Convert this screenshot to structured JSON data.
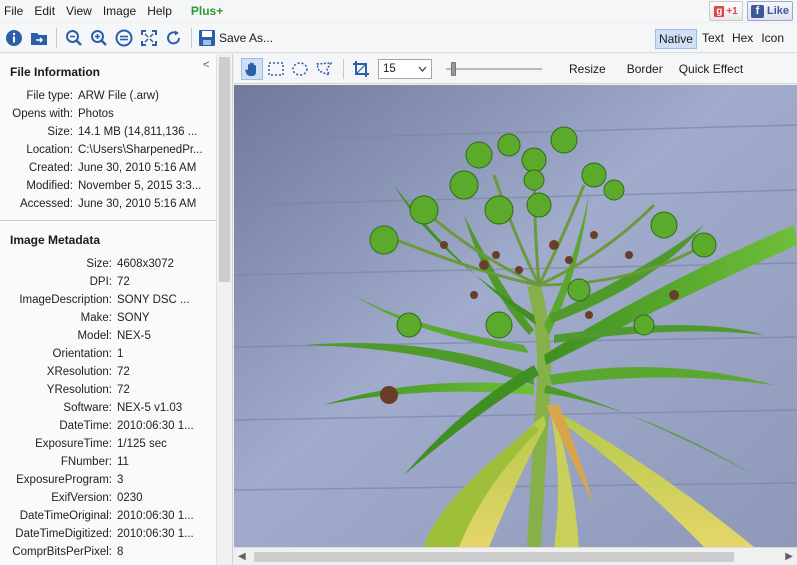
{
  "menu": [
    "File",
    "Edit",
    "View",
    "Image",
    "Help"
  ],
  "plus_label": "Plus+",
  "social": {
    "gplus": "+1",
    "fb": "Like"
  },
  "toolbar": {
    "save_label": "Save As..."
  },
  "view_modes": [
    "Native",
    "Text",
    "Hex",
    "Icon"
  ],
  "view_active": "Native",
  "file_info": {
    "title": "File Information",
    "rows": [
      {
        "k": "File type:",
        "v": "ARW File (.arw)"
      },
      {
        "k": "Opens with:",
        "v": "Photos"
      },
      {
        "k": "Size:",
        "v": "14.1 MB (14,811,136 ..."
      },
      {
        "k": "Location:",
        "v": "C:\\Users\\SharpenedPr..."
      },
      {
        "k": "Created:",
        "v": "June 30, 2010 5:16 AM"
      },
      {
        "k": "Modified:",
        "v": "November 5, 2015 3:3..."
      },
      {
        "k": "Accessed:",
        "v": "June 30, 2010 5:16 AM"
      }
    ]
  },
  "image_meta": {
    "title": "Image Metadata",
    "rows": [
      {
        "k": "Size:",
        "v": "4608x3072"
      },
      {
        "k": "DPI:",
        "v": "72"
      },
      {
        "k": "ImageDescription:",
        "v": "SONY DSC          ..."
      },
      {
        "k": "Make:",
        "v": "SONY"
      },
      {
        "k": "Model:",
        "v": "NEX-5"
      },
      {
        "k": "Orientation:",
        "v": "1"
      },
      {
        "k": "XResolution:",
        "v": "72"
      },
      {
        "k": "YResolution:",
        "v": "72"
      },
      {
        "k": "Software:",
        "v": "NEX-5 v1.03"
      },
      {
        "k": "DateTime:",
        "v": "2010:06:30 1..."
      },
      {
        "k": "ExposureTime:",
        "v": "1/125 sec"
      },
      {
        "k": "FNumber:",
        "v": "11"
      },
      {
        "k": "ExposureProgram:",
        "v": "3"
      },
      {
        "k": "ExifVersion:",
        "v": "0230"
      },
      {
        "k": "DateTimeOriginal:",
        "v": "2010:06:30 1..."
      },
      {
        "k": "DateTimeDigitized:",
        "v": "2010:06:30 1..."
      },
      {
        "k": "ComprBitsPerPixel:",
        "v": "8"
      }
    ]
  },
  "image_toolbar": {
    "zoom_value": "15",
    "slider_level": 0.05,
    "resize_label": "Resize",
    "border_label": "Border",
    "quick_effect_label": "Quick Effect"
  },
  "colors": {
    "wall": "#9ba5c5",
    "leaf": "#4a9a2a",
    "stem": "#7fb04a",
    "accent": "#3b76c4"
  }
}
